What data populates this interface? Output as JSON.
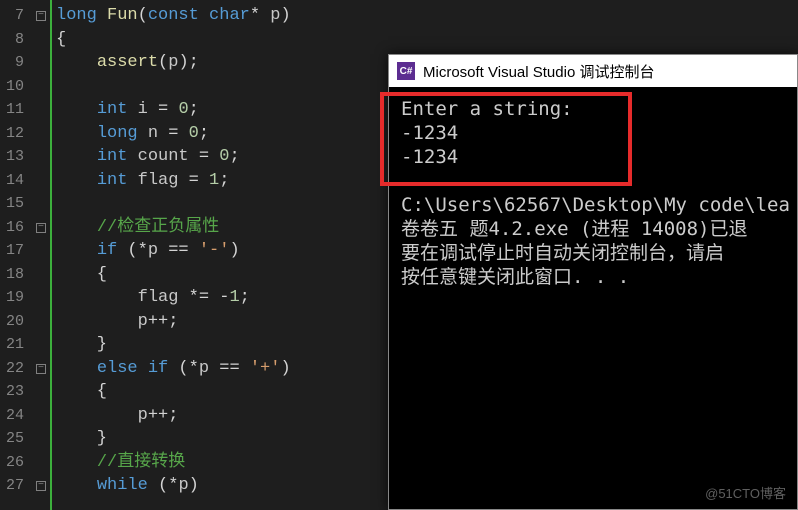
{
  "gutter": {
    "start": 7,
    "end": 27
  },
  "fold_markers": {
    "0": "-",
    "1": "",
    "9": "-",
    "10": "",
    "15": "-",
    "16": "",
    "20": "-"
  },
  "code_lines": [
    [
      {
        "c": "ty",
        "t": "long"
      },
      {
        "c": "pl",
        "t": " "
      },
      {
        "c": "fn",
        "t": "Fun"
      },
      {
        "c": "pl",
        "t": "("
      },
      {
        "c": "ty",
        "t": "const"
      },
      {
        "c": "pl",
        "t": " "
      },
      {
        "c": "ty",
        "t": "char"
      },
      {
        "c": "op",
        "t": "*"
      },
      {
        "c": "pl",
        "t": " "
      },
      {
        "c": "id",
        "t": "p"
      },
      {
        "c": "pl",
        "t": ")"
      }
    ],
    [
      {
        "c": "pl",
        "t": "{"
      }
    ],
    [
      {
        "c": "pl",
        "t": "    "
      },
      {
        "c": "fn",
        "t": "assert"
      },
      {
        "c": "pl",
        "t": "("
      },
      {
        "c": "id",
        "t": "p"
      },
      {
        "c": "pl",
        "t": ");"
      }
    ],
    [
      {
        "c": "pl",
        "t": ""
      }
    ],
    [
      {
        "c": "pl",
        "t": "    "
      },
      {
        "c": "ty",
        "t": "int"
      },
      {
        "c": "pl",
        "t": " "
      },
      {
        "c": "id",
        "t": "i"
      },
      {
        "c": "pl",
        "t": " = "
      },
      {
        "c": "num",
        "t": "0"
      },
      {
        "c": "pl",
        "t": ";"
      }
    ],
    [
      {
        "c": "pl",
        "t": "    "
      },
      {
        "c": "ty",
        "t": "long"
      },
      {
        "c": "pl",
        "t": " "
      },
      {
        "c": "id",
        "t": "n"
      },
      {
        "c": "pl",
        "t": " = "
      },
      {
        "c": "num",
        "t": "0"
      },
      {
        "c": "pl",
        "t": ";"
      }
    ],
    [
      {
        "c": "pl",
        "t": "    "
      },
      {
        "c": "ty",
        "t": "int"
      },
      {
        "c": "pl",
        "t": " "
      },
      {
        "c": "id",
        "t": "count"
      },
      {
        "c": "pl",
        "t": " = "
      },
      {
        "c": "num",
        "t": "0"
      },
      {
        "c": "pl",
        "t": ";"
      }
    ],
    [
      {
        "c": "pl",
        "t": "    "
      },
      {
        "c": "ty",
        "t": "int"
      },
      {
        "c": "pl",
        "t": " "
      },
      {
        "c": "id",
        "t": "flag"
      },
      {
        "c": "pl",
        "t": " = "
      },
      {
        "c": "num",
        "t": "1"
      },
      {
        "c": "pl",
        "t": ";"
      }
    ],
    [
      {
        "c": "pl",
        "t": ""
      }
    ],
    [
      {
        "c": "pl",
        "t": "    "
      },
      {
        "c": "cm",
        "t": "//检查正负属性"
      }
    ],
    [
      {
        "c": "pl",
        "t": "    "
      },
      {
        "c": "kw",
        "t": "if"
      },
      {
        "c": "pl",
        "t": " ("
      },
      {
        "c": "op",
        "t": "*"
      },
      {
        "c": "id",
        "t": "p"
      },
      {
        "c": "pl",
        "t": " == "
      },
      {
        "c": "str",
        "t": "'-'"
      },
      {
        "c": "pl",
        "t": ")"
      }
    ],
    [
      {
        "c": "pl",
        "t": "    {"
      }
    ],
    [
      {
        "c": "pl",
        "t": "        "
      },
      {
        "c": "id",
        "t": "flag"
      },
      {
        "c": "pl",
        "t": " *= "
      },
      {
        "c": "op",
        "t": "-"
      },
      {
        "c": "num",
        "t": "1"
      },
      {
        "c": "pl",
        "t": ";"
      }
    ],
    [
      {
        "c": "pl",
        "t": "        "
      },
      {
        "c": "id",
        "t": "p"
      },
      {
        "c": "op",
        "t": "++"
      },
      {
        "c": "pl",
        "t": ";"
      }
    ],
    [
      {
        "c": "pl",
        "t": "    }"
      }
    ],
    [
      {
        "c": "pl",
        "t": "    "
      },
      {
        "c": "kw",
        "t": "else"
      },
      {
        "c": "pl",
        "t": " "
      },
      {
        "c": "kw",
        "t": "if"
      },
      {
        "c": "pl",
        "t": " ("
      },
      {
        "c": "op",
        "t": "*"
      },
      {
        "c": "id",
        "t": "p"
      },
      {
        "c": "pl",
        "t": " == "
      },
      {
        "c": "str",
        "t": "'+'"
      },
      {
        "c": "pl",
        "t": ")"
      }
    ],
    [
      {
        "c": "pl",
        "t": "    {"
      }
    ],
    [
      {
        "c": "pl",
        "t": "        "
      },
      {
        "c": "id",
        "t": "p"
      },
      {
        "c": "op",
        "t": "++"
      },
      {
        "c": "pl",
        "t": ";"
      }
    ],
    [
      {
        "c": "pl",
        "t": "    }"
      }
    ],
    [
      {
        "c": "pl",
        "t": "    "
      },
      {
        "c": "cm",
        "t": "//直接转换"
      }
    ],
    [
      {
        "c": "pl",
        "t": "    "
      },
      {
        "c": "kw",
        "t": "while"
      },
      {
        "c": "pl",
        "t": " ("
      },
      {
        "c": "op",
        "t": "*"
      },
      {
        "c": "id",
        "t": "p"
      },
      {
        "c": "pl",
        "t": ")"
      }
    ]
  ],
  "console": {
    "icon_text": "C#",
    "title": "Microsoft Visual Studio 调试控制台",
    "lines": [
      "Enter a string:",
      "-1234",
      "-1234",
      "",
      "C:\\Users\\62567\\Desktop\\My code\\lea",
      "卷卷五 题4.2.exe (进程 14008)已退",
      "要在调试停止时自动关闭控制台，请启",
      "按任意键关闭此窗口. . ."
    ]
  },
  "watermark": "@51CTO博客"
}
